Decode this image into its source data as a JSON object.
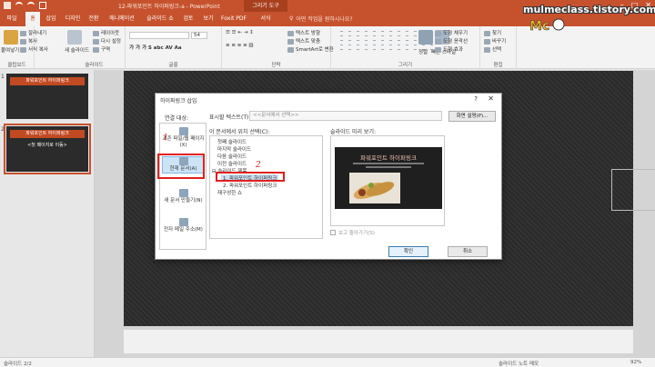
{
  "app": {
    "title": "12-파워포인트 하이퍼링크-a - PowerPoint",
    "context_tab": "그리기 도구"
  },
  "ribbon_tabs": [
    {
      "label": "파일"
    },
    {
      "label": "홈"
    },
    {
      "label": "삽입"
    },
    {
      "label": "디자인"
    },
    {
      "label": "전환"
    },
    {
      "label": "애니메이션"
    },
    {
      "label": "슬라이드 쇼"
    },
    {
      "label": "검토"
    },
    {
      "label": "보기"
    },
    {
      "label": "Foxit PDF"
    },
    {
      "label": "서식"
    }
  ],
  "tell_me": "어떤 작업을 원하시나요?",
  "ribbon": {
    "clipboard": {
      "label": "클립보드",
      "paste": "붙여넣기",
      "cut": "잘라내기",
      "copy": "복사",
      "format_painter": "서식 복사"
    },
    "slides": {
      "label": "슬라이드",
      "new_slide": "새 슬라이드",
      "layout": "레이아웃",
      "reset": "다시 설정",
      "section": "구역"
    },
    "font": {
      "label": "글꼴",
      "size": "54"
    },
    "paragraph": {
      "label": "단락",
      "text_direction": "텍스트 방향",
      "align_text": "텍스트 맞춤",
      "smartart": "SmartArt로 변환"
    },
    "drawing": {
      "label": "그리기",
      "arrange": "정렬",
      "quick_styles": "빠른 스타일",
      "shape_fill": "도형 채우기",
      "shape_outline": "도형 윤곽선",
      "shape_effects": "도형 효과"
    },
    "editing": {
      "label": "편집",
      "find": "찾기",
      "replace": "바꾸기",
      "select": "선택"
    }
  },
  "watermark": "mulmeclass.tistory.com",
  "slides": [
    {
      "number": "1",
      "title": "파워포인트 하이퍼링크",
      "subtitle": ""
    },
    {
      "number": "2",
      "title": "파워포인트 하이퍼링크",
      "subtitle": "<첫 페이지로 이동>"
    }
  ],
  "status": {
    "slide_count": "슬라이드 2/2",
    "notes": "슬라이드 노트",
    "comments": "메모",
    "zoom": "92%"
  },
  "dialog": {
    "title": "하이퍼링크 삽입",
    "help": "?",
    "close": "✕",
    "link_to_label": "연결 대상:",
    "link_options": [
      {
        "label": "기존 파일/웹 페이지(X)"
      },
      {
        "label": "현재 문서(A)"
      },
      {
        "label": "새 문서 만들기(N)"
      },
      {
        "label": "전자 메일 주소(M)"
      }
    ],
    "display_text_label": "표시할 텍스트(T):",
    "display_text_value": "<<문서에서 선택>>",
    "screentip_button": "화면 설명(P)...",
    "place_label": "이 문서에서 위치 선택(C):",
    "tree": [
      {
        "label": "첫째 슬라이드"
      },
      {
        "label": "마지막 슬라이드"
      },
      {
        "label": "다음 슬라이드"
      },
      {
        "label": "이전 슬라이드"
      },
      {
        "label": "슬라이드 제목"
      },
      {
        "label": "1. 파워포인트 하이퍼링크"
      },
      {
        "label": "2. 파워포인트 하이퍼링크"
      },
      {
        "label": "재구성한 쇼"
      }
    ],
    "preview_label": "슬라이드 미리 보기:",
    "preview_title": "파워포인트 하이퍼링크",
    "show_return": "보고 돌아가기(S)",
    "ok": "확인",
    "cancel": "취소"
  },
  "annotations": {
    "step1": "1",
    "step2": "2"
  }
}
